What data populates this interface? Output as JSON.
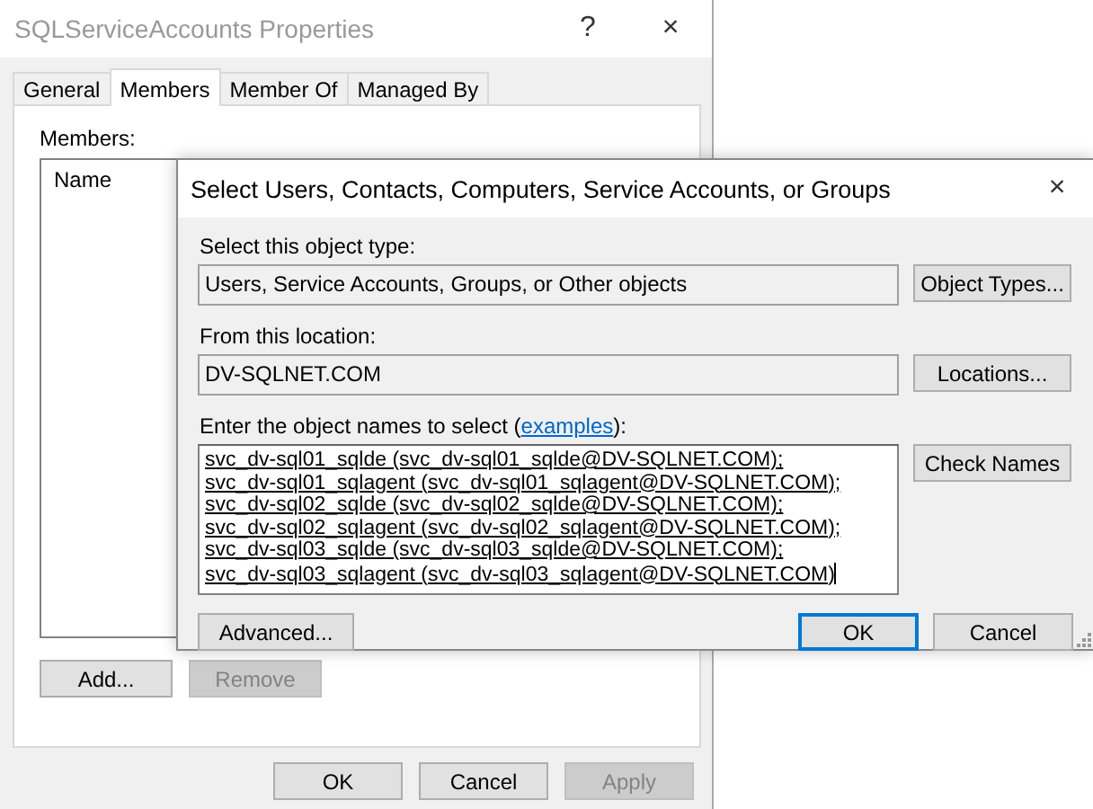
{
  "properties_window": {
    "title": "SQLServiceAccounts Properties",
    "help_button": "?",
    "close_button": "×",
    "tabs": [
      {
        "label": "General",
        "selected": false
      },
      {
        "label": "Members",
        "selected": true
      },
      {
        "label": "Member Of",
        "selected": false
      },
      {
        "label": "Managed By",
        "selected": false
      }
    ],
    "members_label": "Members:",
    "members_list": {
      "columns": [
        "Name"
      ]
    },
    "list_buttons": [
      {
        "label": "Add...",
        "disabled": false
      },
      {
        "label": "Remove",
        "disabled": true
      }
    ],
    "footer_buttons": [
      {
        "label": "OK",
        "disabled": false
      },
      {
        "label": "Cancel",
        "disabled": false
      },
      {
        "label": "Apply",
        "disabled": true
      }
    ]
  },
  "select_dialog": {
    "title": "Select Users, Contacts, Computers, Service Accounts, or Groups",
    "close_button": "×",
    "object_type_label": "Select this object type:",
    "object_type_value": "Users, Service Accounts, Groups, or Other objects",
    "object_types_button": "Object Types...",
    "location_label": "From this location:",
    "location_value": "DV-SQLNET.COM",
    "locations_button": "Locations...",
    "names_label": {
      "before": "Enter the object names to select (",
      "link": "examples",
      "after": "):"
    },
    "names": [
      "svc_dv-sql01_sqlde (svc_dv-sql01_sqlde@DV-SQLNET.COM);",
      "svc_dv-sql01_sqlagent (svc_dv-sql01_sqlagent@DV-SQLNET.COM);",
      "svc_dv-sql02_sqlde (svc_dv-sql02_sqlde@DV-SQLNET.COM);",
      "svc_dv-sql02_sqlagent (svc_dv-sql02_sqlagent@DV-SQLNET.COM);",
      "svc_dv-sql03_sqlde (svc_dv-sql03_sqlde@DV-SQLNET.COM);",
      "svc_dv-sql03_sqlagent (svc_dv-sql03_sqlagent@DV-SQLNET.COM)"
    ],
    "check_names_button": "Check Names",
    "buttons": [
      {
        "label": "Advanced...",
        "default": false
      },
      {
        "label": "OK",
        "default": true
      },
      {
        "label": "Cancel",
        "default": false
      }
    ]
  }
}
